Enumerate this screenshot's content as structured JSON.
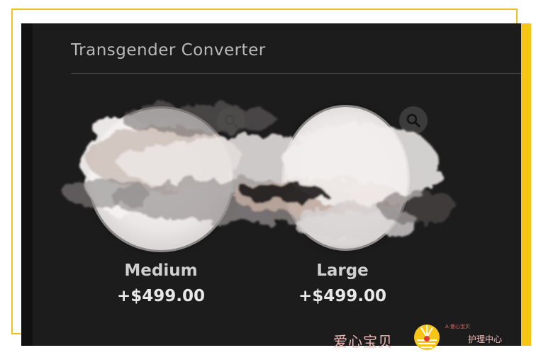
{
  "page": {
    "title": "Transgender Converter"
  },
  "products": [
    {
      "name": "Medium",
      "price": "+$499.00"
    },
    {
      "name": "Large",
      "price": "+$499.00"
    }
  ],
  "icons": {
    "zoom": "search-icon"
  },
  "watermark": {
    "brand_cn": "爱心宝贝",
    "small_line": "A·爱心宝贝",
    "sub_line": "护理中心"
  },
  "colors": {
    "background": "#1d1c1d",
    "frame_accent": "#f7c514",
    "text_primary": "#e8e8e8",
    "text_secondary": "#b9b9b9"
  }
}
